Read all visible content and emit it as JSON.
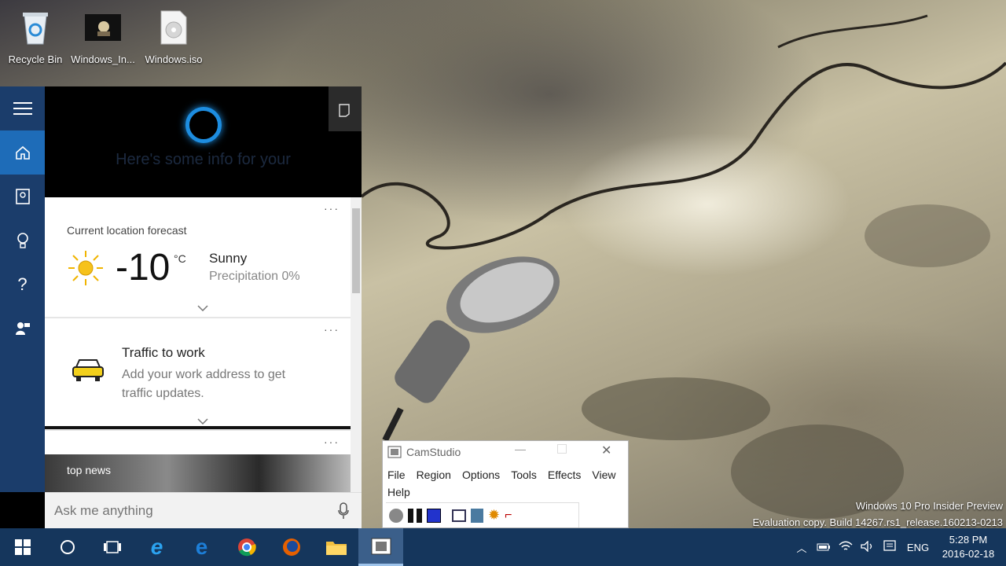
{
  "desktop": {
    "icons": [
      {
        "label": "Recycle Bin",
        "icon": "recycle-bin-icon"
      },
      {
        "label": "Windows_In...",
        "icon": "video-file-icon"
      },
      {
        "label": "Windows.iso",
        "icon": "disc-image-icon"
      }
    ],
    "watermark": {
      "line1": "Windows 10 Pro Insider Preview",
      "line2": "Evaluation copy. Build 14267.rs1_release.160213-0213"
    }
  },
  "cortana": {
    "greeting": "Here's some info for your",
    "rail": [
      "hamburger-menu-icon",
      "home-icon",
      "notebook-icon",
      "lightbulb-icon",
      "help-icon",
      "feedback-icon"
    ],
    "weather": {
      "title": "Current location forecast",
      "temp": "-10",
      "unit": "°C",
      "condition": "Sunny",
      "precip": "Precipitation 0%"
    },
    "traffic": {
      "title": "Traffic to work",
      "desc1": "Add your work address to get",
      "desc2": "traffic updates."
    },
    "news": {
      "label": "top news"
    },
    "search": {
      "placeholder": "Ask me anything"
    },
    "accent": "#1d8de0"
  },
  "camstudio": {
    "title": "CamStudio",
    "menu": [
      "File",
      "Region",
      "Options",
      "Tools",
      "Effects",
      "View",
      "Help"
    ]
  },
  "taskbar": {
    "lang": "ENG",
    "time": "5:28 PM",
    "date": "2016-02-18",
    "color": "#15365c"
  }
}
